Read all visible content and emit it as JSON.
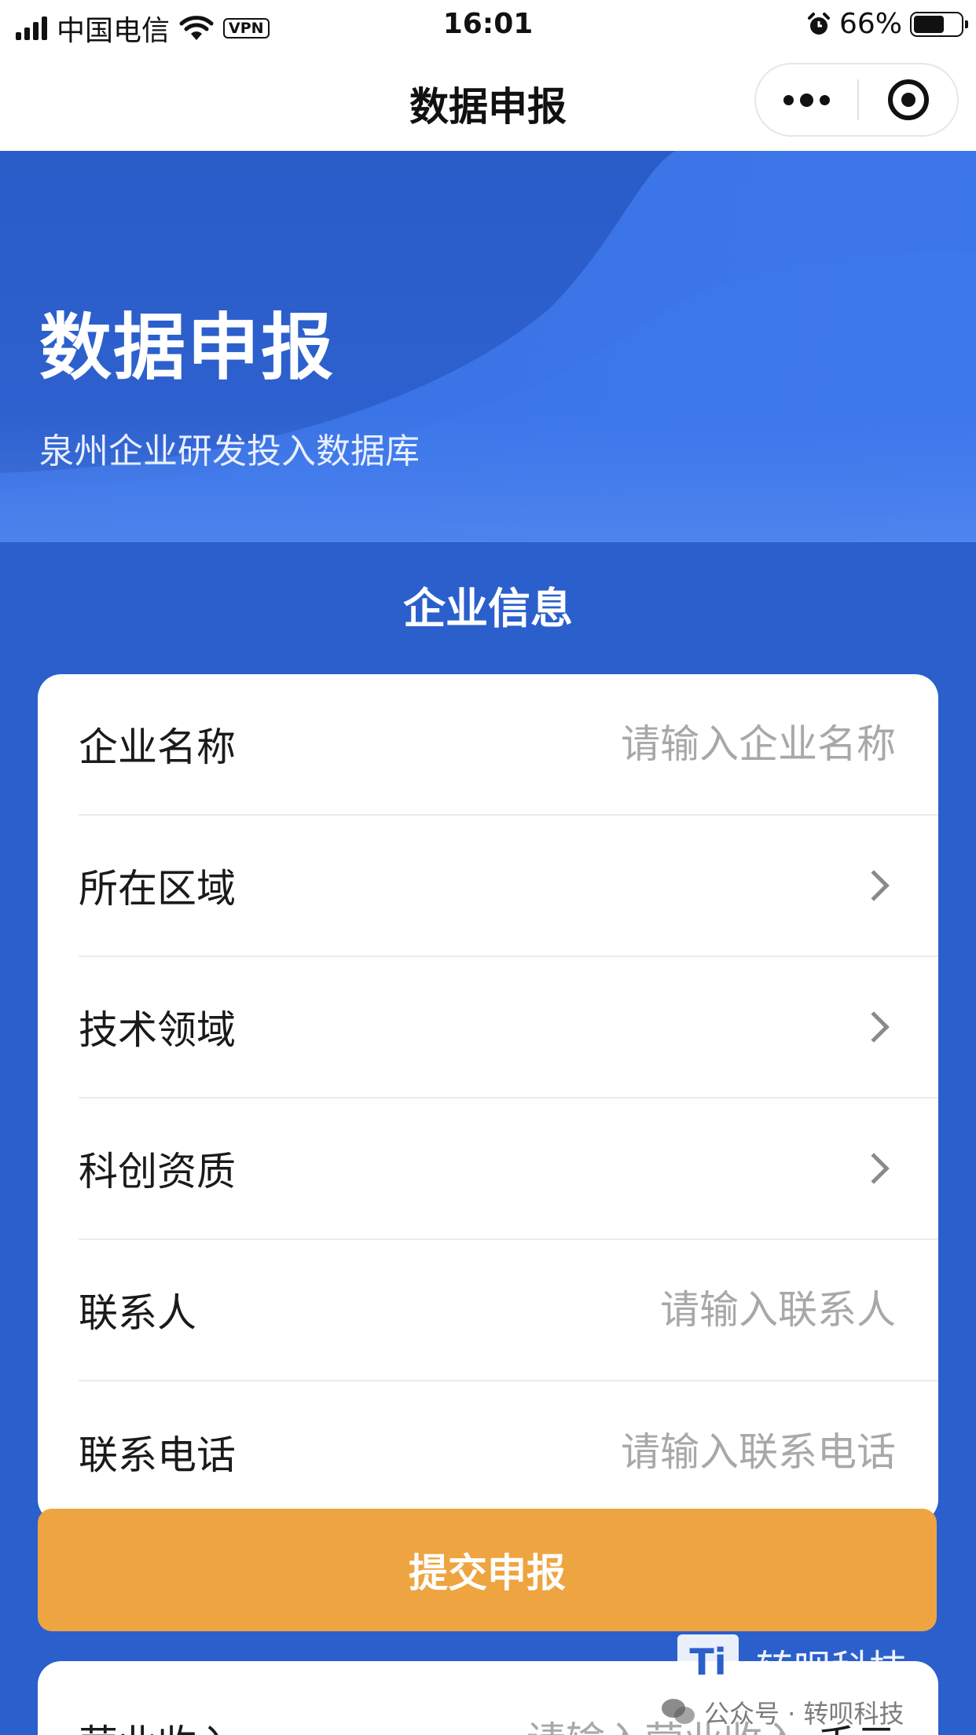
{
  "status_bar": {
    "carrier": "中国电信",
    "vpn": "VPN",
    "time": "16:01",
    "battery": "66%",
    "battery_level": 0.66,
    "icons": [
      "signal-icon",
      "wifi-icon",
      "alarm-icon",
      "battery-icon"
    ]
  },
  "nav": {
    "title": "数据申报",
    "icons": [
      "more-icon",
      "target-icon"
    ]
  },
  "hero": {
    "title": "数据申报",
    "subtitle": "泉州企业研发投入数据库"
  },
  "section": {
    "title": "企业信息"
  },
  "form": {
    "rows": [
      {
        "label": "企业名称",
        "type": "input",
        "placeholder": "请输入企业名称"
      },
      {
        "label": "所在区域",
        "type": "picker"
      },
      {
        "label": "技术领域",
        "type": "picker"
      },
      {
        "label": "科创资质",
        "type": "picker"
      },
      {
        "label": "联系人",
        "type": "input",
        "placeholder": "请输入联系人"
      },
      {
        "label": "联系电话",
        "type": "input",
        "placeholder": "请输入联系电话"
      }
    ]
  },
  "submit": {
    "label": "提交申报"
  },
  "form2": {
    "label": "营业收入",
    "placeholder": "请输入营业收入",
    "unit": "千元"
  },
  "watermark": {
    "logo": "Ti",
    "brand": "转呗科技",
    "line": "公众号 · 转呗科技"
  },
  "colors": {
    "primary_blue": "#2b5fcc",
    "submit_orange": "#eea440"
  }
}
